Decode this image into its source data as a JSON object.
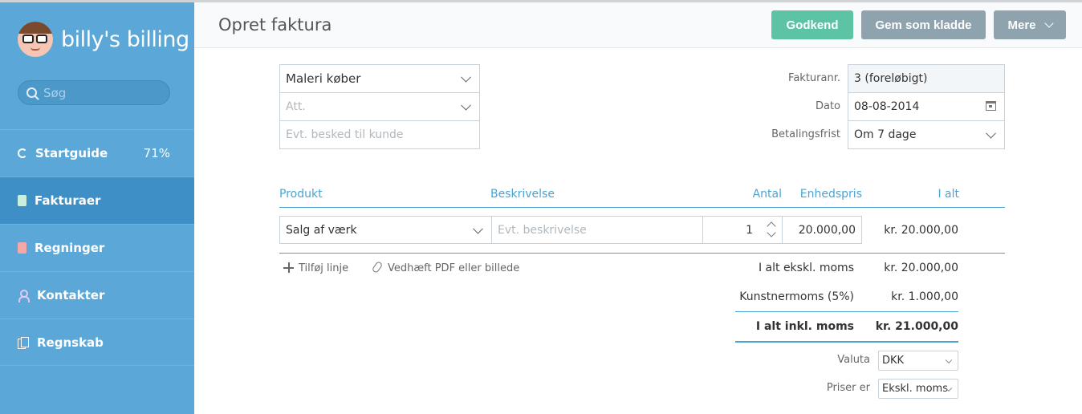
{
  "app": {
    "logo_text": "billy's billing"
  },
  "sidebar": {
    "search_placeholder": "Søg",
    "items": [
      {
        "label": "Startguide",
        "badge": "71%",
        "icon": "progress-icon"
      },
      {
        "label": "Fakturaer",
        "icon": "invoice-icon",
        "active": true
      },
      {
        "label": "Regninger",
        "icon": "bill-icon"
      },
      {
        "label": "Kontakter",
        "icon": "contact-icon"
      },
      {
        "label": "Regnskab",
        "icon": "accounting-icon"
      }
    ]
  },
  "header": {
    "title": "Opret faktura",
    "approve_label": "Godkend",
    "draft_label": "Gem som kladde",
    "more_label": "Mere"
  },
  "customer": {
    "contact_value": "Maleri køber",
    "att_placeholder": "Att.",
    "message_placeholder": "Evt. besked til kunde"
  },
  "invoice_meta": {
    "number_label": "Fakturanr.",
    "number_value": "3 (foreløbigt)",
    "date_label": "Dato",
    "date_value": "08-08-2014",
    "due_label": "Betalingsfrist",
    "due_value": "Om 7 dage"
  },
  "lines": {
    "headers": {
      "product": "Produkt",
      "description": "Beskrivelse",
      "quantity": "Antal",
      "unit_price": "Enhedspris",
      "total": "I alt"
    },
    "rows": [
      {
        "product": "Salg af værk",
        "description_placeholder": "Evt. beskrivelse",
        "quantity": "1",
        "unit_price": "20.000,00",
        "total": "kr. 20.000,00"
      }
    ],
    "add_line_label": "Tilføj linje",
    "attach_label": "Vedhæft PDF eller billede"
  },
  "totals": {
    "excl_label": "I alt ekskl. moms",
    "excl_value": "kr. 20.000,00",
    "tax_label": "Kunstnermoms (5%)",
    "tax_value": "kr. 1.000,00",
    "incl_label": "I alt inkl. moms",
    "incl_value": "kr. 21.000,00"
  },
  "settings": {
    "currency_label": "Valuta",
    "currency_value": "DKK",
    "prices_label": "Priser er",
    "prices_value": "Ekskl. moms"
  },
  "colors": {
    "sidebar_bg": "#5ba8d8",
    "sidebar_active": "#3d8fc6",
    "approve_green": "#5cc3a4",
    "button_grey": "#8fa3ae",
    "accent_blue": "#4ba3d3"
  }
}
